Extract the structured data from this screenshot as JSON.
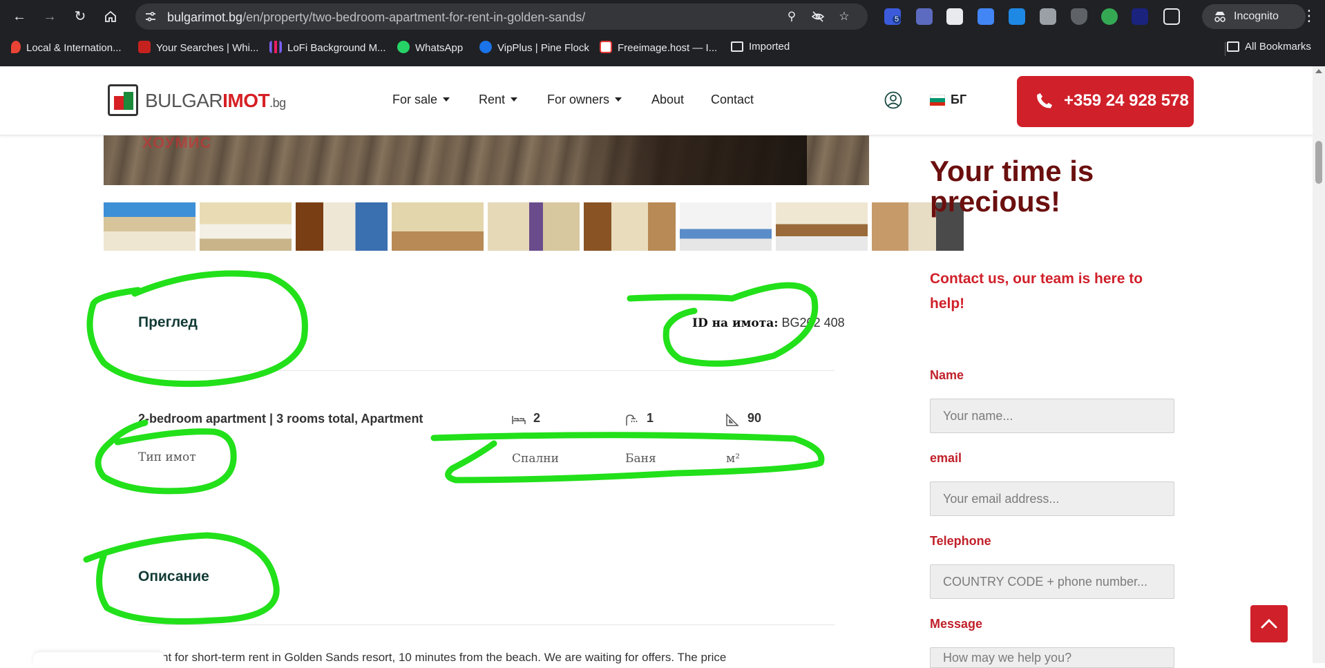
{
  "browser": {
    "url_host": "bulgarimot.bg",
    "url_path": "/en/property/two-bedroom-apartment-for-rent-in-golden-sands/",
    "incognito_label": "Incognito",
    "extension_badge": "5",
    "bookmarks": [
      {
        "label": "Local & Internation...",
        "color": "#ea4335"
      },
      {
        "label": "Your Searches | Whi...",
        "color": "#c5221f"
      },
      {
        "label": "LoFi Background M...",
        "color": "#7b61ff"
      },
      {
        "label": "WhatsApp",
        "color": "#25d366"
      },
      {
        "label": "VipPlus | Pine Flock",
        "color": "#1a73e8"
      },
      {
        "label": "Freeimage.host — I...",
        "color": "#ffffff"
      },
      {
        "label": "Imported",
        "color": "#e8eaed"
      }
    ],
    "all_bookmarks_label": "All Bookmarks"
  },
  "site": {
    "logo": {
      "part1": "BULGAR",
      "part2": "IMOT",
      "part3": ".bg"
    },
    "nav": [
      {
        "label": "For sale",
        "dropdown": true
      },
      {
        "label": "Rent",
        "dropdown": true
      },
      {
        "label": "For owners",
        "dropdown": true
      },
      {
        "label": "About",
        "dropdown": false
      },
      {
        "label": "Contact",
        "dropdown": false
      }
    ],
    "lang": "БГ",
    "phone": "+359 24 928 578",
    "brand_red": "#d0202a",
    "brand_green": "#1b8a3a"
  },
  "listing": {
    "hero_watermark": "ХОУМИС",
    "thumb_count": 8,
    "overview_title": "Преглед",
    "id_label": "ID на имота:",
    "id_value": "BG202 408",
    "type_value": "2-bedroom apartment | 3 rooms total, Apartment",
    "type_label": "Тип имот",
    "bedrooms": {
      "value": "2",
      "label": "Спални"
    },
    "baths": {
      "value": "1",
      "label": "Баня"
    },
    "area": {
      "value": "90",
      "label": "м²"
    },
    "description_title": "Описание",
    "description_text": "rtment for short-term rent in Golden Sands resort, 10 minutes from the beach. We are waiting for offers. The price"
  },
  "sidebar": {
    "title": "Your time is precious!",
    "subtitle": "Contact us, our team is here to help!",
    "fields": [
      {
        "label": "Name",
        "placeholder": "Your name..."
      },
      {
        "label": "email",
        "placeholder": "Your email address..."
      },
      {
        "label": "Telephone",
        "placeholder": "COUNTRY CODE + phone number..."
      },
      {
        "label": "Message",
        "placeholder": "How may we help you?"
      }
    ]
  },
  "annotation_color": "#22e01a"
}
